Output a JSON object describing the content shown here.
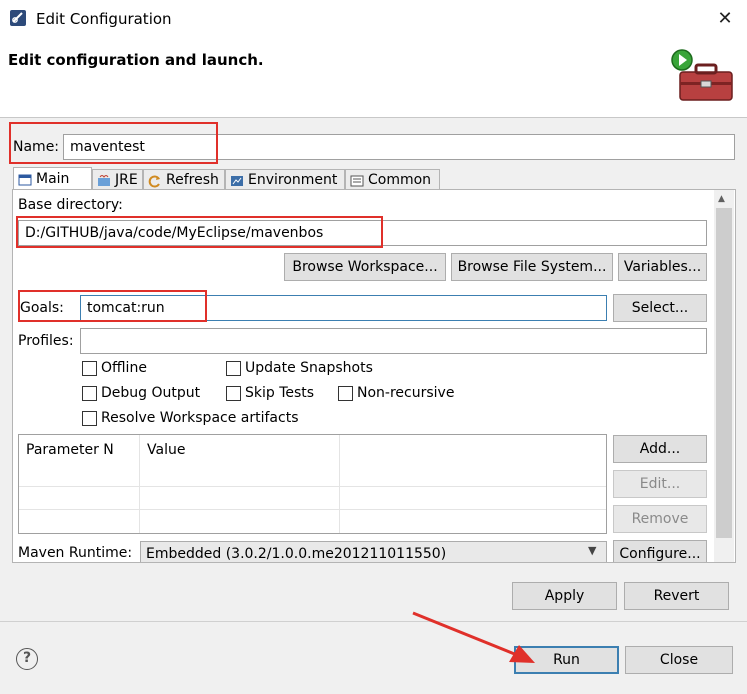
{
  "window": {
    "title": "Edit Configuration",
    "close_glyph": "✕"
  },
  "header": {
    "title": "Edit configuration and launch."
  },
  "name": {
    "label": "Name:",
    "value": "maventest"
  },
  "tabs": [
    {
      "label": "Main",
      "icon": "main-icon"
    },
    {
      "label": "JRE",
      "icon": "jre-icon"
    },
    {
      "label": "Refresh",
      "icon": "refresh-icon"
    },
    {
      "label": "Environment",
      "icon": "environment-icon"
    },
    {
      "label": "Common",
      "icon": "common-icon"
    }
  ],
  "main": {
    "base_dir_label": "Base directory:",
    "base_dir_value": "D:/GITHUB/java/code/MyEclipse/mavenbos",
    "browse_workspace": "Browse Workspace...",
    "browse_fs": "Browse File System...",
    "variables": "Variables...",
    "goals_label": "Goals:",
    "goals_value": "tomcat:run",
    "select": "Select...",
    "profiles_label": "Profiles:",
    "profiles_value": "",
    "checkboxes": {
      "offline": "Offline",
      "update_snapshots": "Update Snapshots",
      "debug_output": "Debug Output",
      "skip_tests": "Skip Tests",
      "non_recursive": "Non-recursive",
      "resolve_workspace": "Resolve Workspace artifacts"
    },
    "table": {
      "col1": "Parameter N",
      "col2": "Value"
    },
    "add": "Add...",
    "edit": "Edit...",
    "remove": "Remove",
    "runtime_label": "Maven Runtime:",
    "runtime_value": "Embedded (3.0.2/1.0.0.me201211011550)",
    "configure": "Configure..."
  },
  "footer": {
    "apply": "Apply",
    "revert": "Revert",
    "run": "Run",
    "close": "Close",
    "help_glyph": "?"
  },
  "colors": {
    "annotation_red": "#e0302a",
    "default_button_border": "#3c7fb1"
  }
}
